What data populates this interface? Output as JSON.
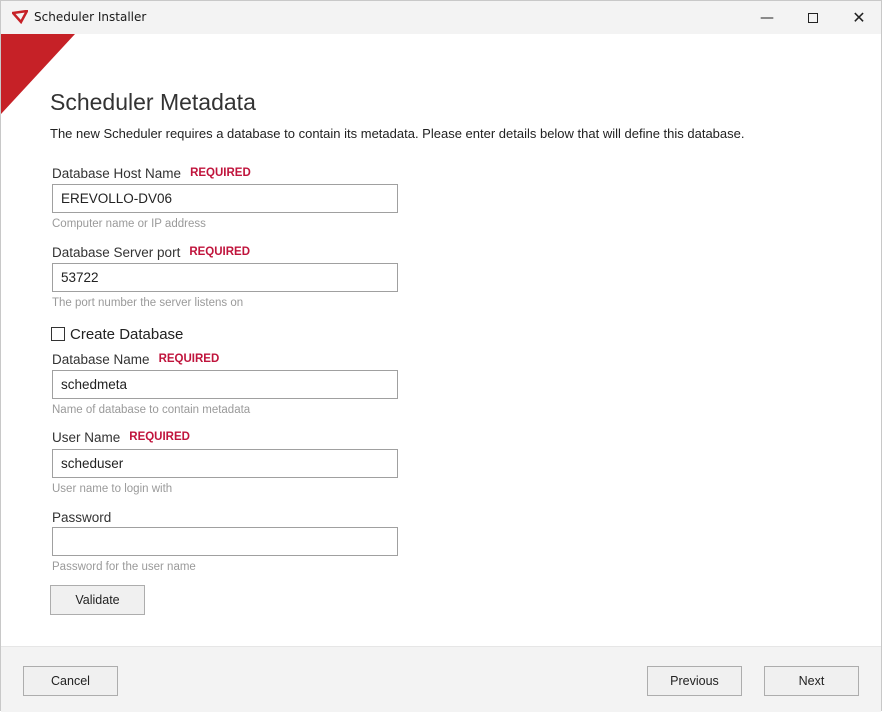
{
  "window": {
    "title": "Scheduler Installer"
  },
  "page": {
    "heading": "Scheduler Metadata",
    "description": "The new Scheduler requires a database to contain its metadata. Please enter details below that will define this database."
  },
  "required_label": "REQUIRED",
  "fields": {
    "host": {
      "label": "Database Host Name",
      "value": "EREVOLLO-DV06",
      "hint": "Computer name or IP address"
    },
    "port": {
      "label": "Database Server port",
      "value": "53722",
      "hint": "The port number the server listens on"
    },
    "dbname": {
      "label": "Database Name",
      "value": "schedmeta",
      "hint": "Name of database to contain metadata"
    },
    "user": {
      "label": "User Name",
      "value": "scheduser",
      "hint": "User name to login with"
    },
    "password": {
      "label": "Password",
      "value": "",
      "hint": "Password for the user name"
    }
  },
  "create_database": {
    "label": "Create Database",
    "checked": false
  },
  "buttons": {
    "validate": "Validate",
    "cancel": "Cancel",
    "previous": "Previous",
    "next": "Next"
  },
  "colors": {
    "accent": "#c62127",
    "required": "#c0143c"
  }
}
